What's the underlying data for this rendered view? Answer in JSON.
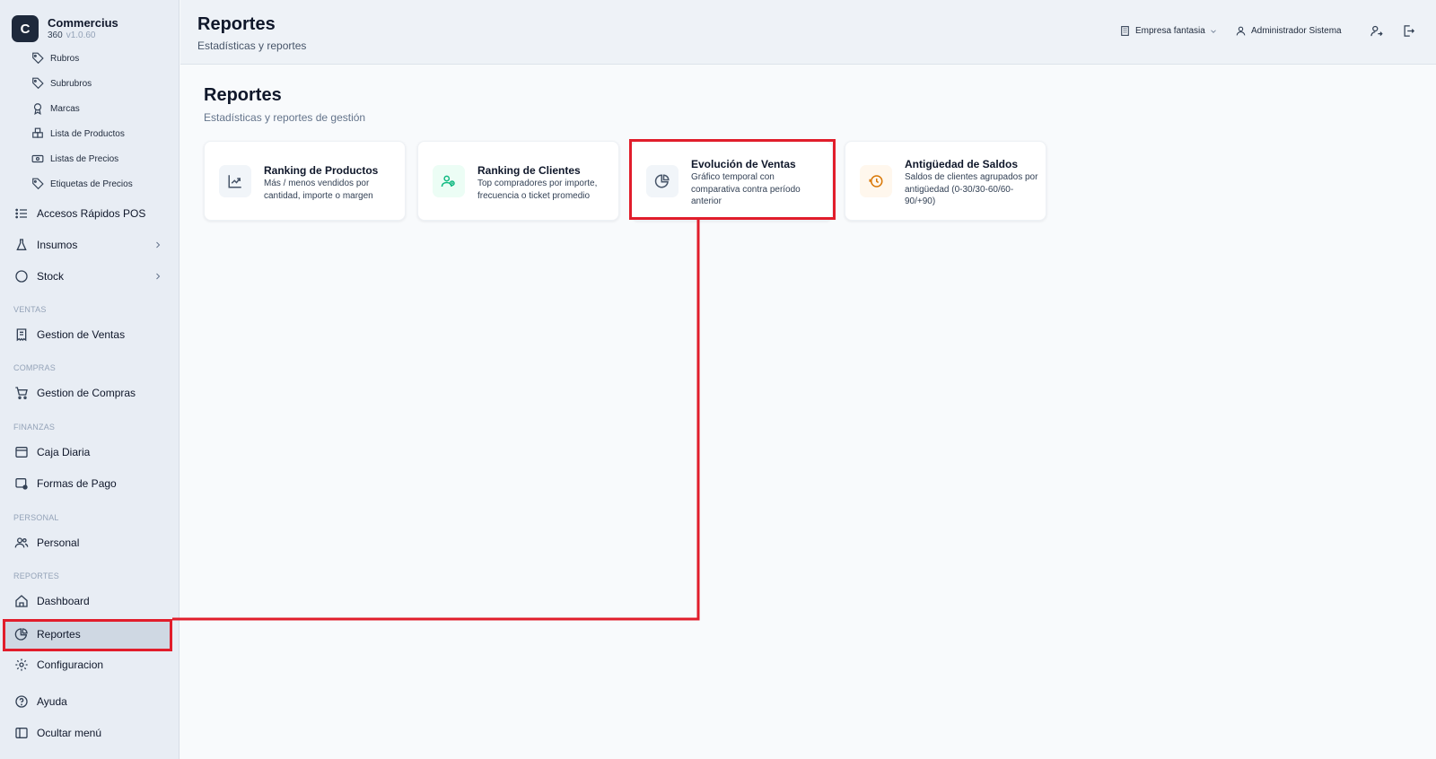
{
  "brand": {
    "logo_letter": "C",
    "name": "Commercius",
    "subtitle": "360",
    "version": "v1.0.60"
  },
  "sidebar": {
    "sub_items": [
      {
        "label": "Rubros",
        "icon": "tag-icon"
      },
      {
        "label": "Subrubros",
        "icon": "tag-icon"
      },
      {
        "label": "Marcas",
        "icon": "award-icon"
      },
      {
        "label": "Lista de Productos",
        "icon": "boxes-icon"
      },
      {
        "label": "Listas de Precios",
        "icon": "banknote-icon"
      },
      {
        "label": "Etiquetas de Precios",
        "icon": "tag-icon"
      }
    ],
    "items": [
      {
        "label": "Accesos Rápidos POS",
        "icon": "list-icon"
      },
      {
        "label": "Insumos",
        "icon": "flask-icon"
      },
      {
        "label": "Stock",
        "icon": "circle-icon"
      },
      {
        "label": "Gestion de Ventas",
        "icon": "receipt-icon"
      },
      {
        "label": "Gestion de Compras",
        "icon": "cart-icon"
      },
      {
        "label": "Caja Diaria",
        "icon": "cash-box-icon"
      },
      {
        "label": "Formas de Pago",
        "icon": "card-icon"
      },
      {
        "label": "Personal",
        "icon": "users-icon"
      },
      {
        "label": "Dashboard",
        "icon": "home-icon"
      },
      {
        "label": "Reportes",
        "icon": "chart-pie-icon"
      },
      {
        "label": "Configuracion",
        "icon": "gear-icon"
      },
      {
        "label": "Ayuda",
        "icon": "help-icon"
      },
      {
        "label": "Ocultar menú",
        "icon": "panel-left-icon"
      }
    ],
    "sections": [
      "VENTAS",
      "COMPRAS",
      "FINANZAS",
      "PERSONAL",
      "REPORTES"
    ],
    "active_item": "Reportes"
  },
  "header": {
    "title": "Reportes",
    "subtitle": "Estadísticas y reportes",
    "company": "Empresa fantasia",
    "user": "Administrador Sistema"
  },
  "main": {
    "title": "Reportes",
    "subtitle": "Estadísticas y reportes de gestión",
    "cards": [
      {
        "title": "Ranking de Productos",
        "description": "Más / menos vendidos por cantidad, importe o margen",
        "icon": "trending-up-icon",
        "icon_bg": "#f1f5f9",
        "icon_color": "#475569"
      },
      {
        "title": "Ranking de Clientes",
        "description": "Top compradores por importe, frecuencia o ticket promedio",
        "icon": "users-icon",
        "icon_bg": "#ecfdf5",
        "icon_color": "#10b981"
      },
      {
        "title": "Evolución de Ventas",
        "description": "Gráfico temporal con comparativa contra período anterior",
        "icon": "chart-pie-icon",
        "icon_bg": "#f1f5f9",
        "icon_color": "#475569"
      },
      {
        "title": "Antigüedad de Saldos",
        "description": "Saldos de clientes agrupados por antigüedad (0-30/30-60/60-90/+90)",
        "icon": "clock-alert-icon",
        "icon_bg": "#fff7ed",
        "icon_color": "#d97706"
      }
    ]
  },
  "colors": {
    "highlight": "#e11d2b",
    "sidebar_bg": "#e8edf4",
    "active_bg": "#cfd8e3"
  }
}
